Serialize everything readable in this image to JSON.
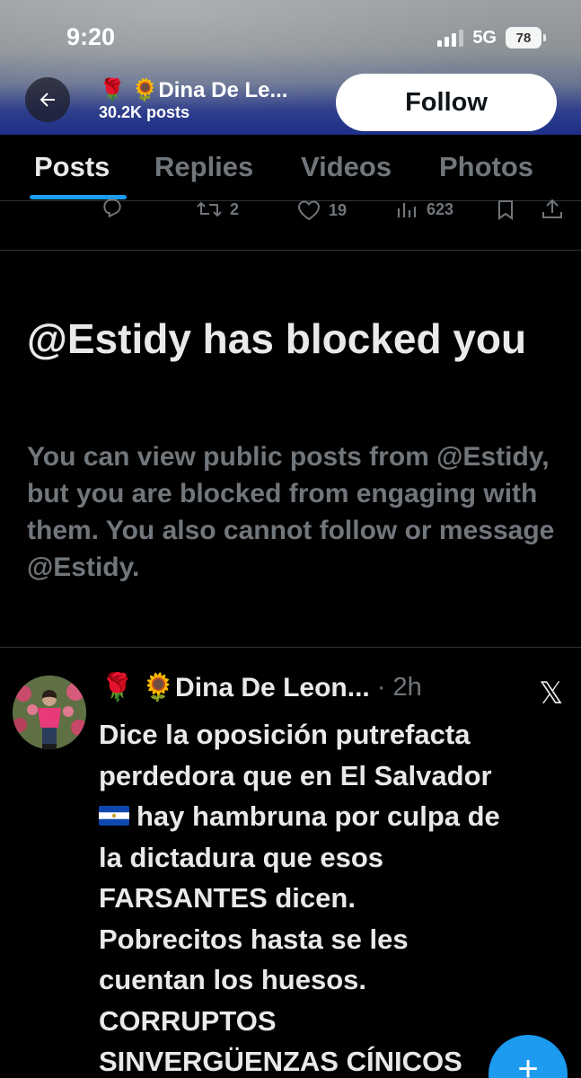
{
  "status_bar": {
    "time": "9:20",
    "network": "5G",
    "battery": "78"
  },
  "header": {
    "profile_name": "🌹 🌻Dina De Le...",
    "post_count": "30.2K posts",
    "follow_label": "Follow"
  },
  "tabs": [
    {
      "label": "Posts",
      "active": true
    },
    {
      "label": "Replies",
      "active": false
    },
    {
      "label": "Videos",
      "active": false
    },
    {
      "label": "Photos",
      "active": false
    }
  ],
  "prev_post_actions": {
    "reposts": "2",
    "likes": "19",
    "views": "623"
  },
  "blocked_notice": {
    "title": "@Estidy has blocked you",
    "body": "You can view public posts from @Estidy, but you are blocked from engaging with them. You also cannot follow or message @Estidy."
  },
  "post": {
    "author": "🌹 🌻Dina De Leon...",
    "time": "· 2h",
    "lines": [
      "Dice la oposición putrefacta",
      "perdedora que en El Salvador",
      "hay hambruna por culpa de",
      "la dictadura que esos",
      "FARSANTES dicen.",
      "Pobrecitos hasta se les",
      "cuentan los huesos.",
      "CORRUPTOS",
      "SINVERGÜENZAS CÍNICOS"
    ]
  },
  "icons": [
    "back-arrow-icon",
    "reply-icon",
    "repost-icon",
    "like-icon",
    "views-icon",
    "bookmark-icon",
    "share-icon",
    "x-logo-icon",
    "compose-icon"
  ],
  "colors": {
    "accent": "#1d9bf0",
    "muted": "#71767b",
    "text": "#e7e9ea",
    "background": "#000000"
  }
}
